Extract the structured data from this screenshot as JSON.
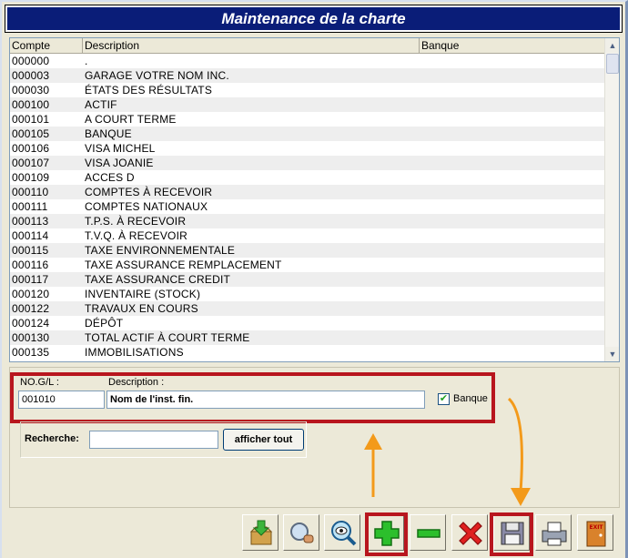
{
  "window": {
    "title": "Maintenance de la charte"
  },
  "list": {
    "columns": [
      "Compte",
      "Description",
      "Banque"
    ],
    "rows": [
      [
        "000000",
        "."
      ],
      [
        "000003",
        "GARAGE VOTRE NOM INC."
      ],
      [
        "000030",
        "ÉTATS DES RÉSULTATS"
      ],
      [
        "000100",
        "ACTIF"
      ],
      [
        "000101",
        "A COURT TERME"
      ],
      [
        "000105",
        "BANQUE"
      ],
      [
        "000106",
        "VISA MICHEL"
      ],
      [
        "000107",
        "VISA JOANIE"
      ],
      [
        "000109",
        "ACCES D"
      ],
      [
        "000110",
        "COMPTES À RECEVOIR"
      ],
      [
        "000111",
        "COMPTES NATIONAUX"
      ],
      [
        "000113",
        "T.P.S. À RECEVOIR"
      ],
      [
        "000114",
        "T.V.Q. À RECEVOIR"
      ],
      [
        "000115",
        "TAXE ENVIRONNEMENTALE"
      ],
      [
        "000116",
        "TAXE ASSURANCE REMPLACEMENT"
      ],
      [
        "000117",
        "TAXE ASSURANCE CREDIT"
      ],
      [
        "000120",
        "INVENTAIRE (STOCK)"
      ],
      [
        "000122",
        "TRAVAUX EN COURS"
      ],
      [
        "000124",
        "DÉPÔT"
      ],
      [
        "000130",
        "TOTAL ACTIF À COURT TERME"
      ],
      [
        "000135",
        "IMMOBILISATIONS"
      ]
    ]
  },
  "form": {
    "gl_label": "NO.G/L :",
    "gl_value": "001010",
    "desc_label": "Description :",
    "desc_value": "Nom de l'inst. fin.",
    "bank_label": "Banque",
    "bank_checked": "✔",
    "search_label": "Recherche:",
    "search_value": "",
    "show_all_label": "afficher tout"
  },
  "toolbar": {
    "exit_label": "EXIT",
    "add_label": "+",
    "remove_label": "−"
  },
  "colors": {
    "title_bg": "#0a1d78",
    "highlight": "#b8161e",
    "arrow": "#f39a1a"
  }
}
